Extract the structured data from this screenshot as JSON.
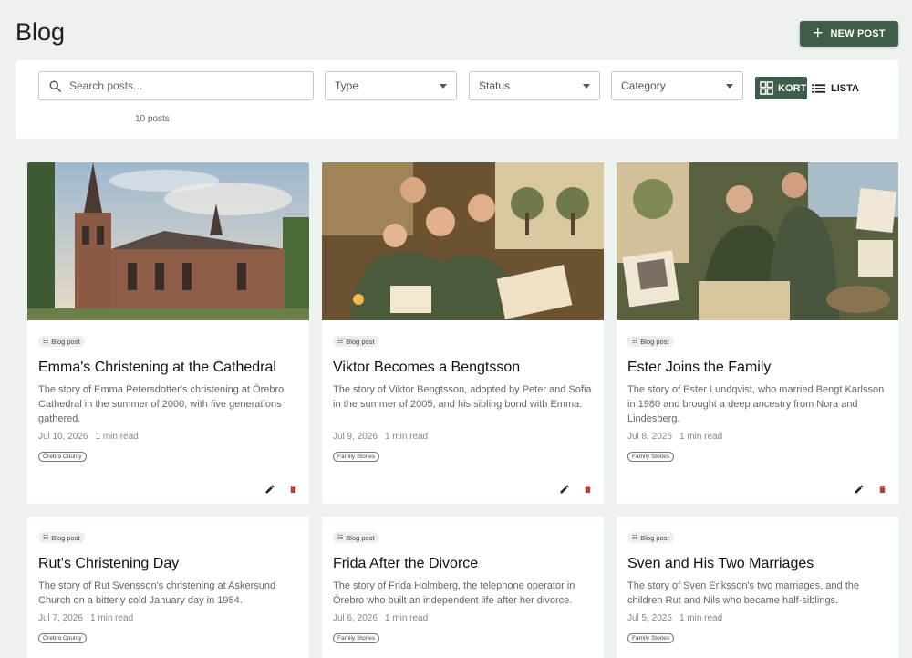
{
  "header": {
    "title": "Blog",
    "new_post_label": "NEW POST"
  },
  "filters": {
    "search_placeholder": "Search posts...",
    "type_label": "Type",
    "status_label": "Status",
    "category_label": "Category",
    "view_card_label": "KORT",
    "view_list_label": "LISTA",
    "post_count": "10 posts"
  },
  "colors": {
    "primary": "#3f5d48",
    "delete": "#b0443a",
    "background": "#eef2ee"
  },
  "posts": [
    {
      "type": "Blog post",
      "title": "Emma's Christening at the Cathedral",
      "description": "The story of Emma Petersdotter's christening at Örebro Cathedral in the summer of 2000, with five generations gathered.",
      "date": "Jul 10, 2026",
      "read_time": "1 min read",
      "category": "Örebro County"
    },
    {
      "type": "Blog post",
      "title": "Viktor Becomes a Bengtsson",
      "description": "The story of Viktor Bengtsson, adopted by Peter and Sofia in the summer of 2005, and his sibling bond with Emma.",
      "date": "Jul 9, 2026",
      "read_time": "1 min read",
      "category": "Family Stories"
    },
    {
      "type": "Blog post",
      "title": "Ester Joins the Family",
      "description": "The story of Ester Lundqvist, who married Bengt Karlsson in 1980 and brought a deep ancestry from Nora and Lindesberg.",
      "date": "Jul 8, 2026",
      "read_time": "1 min read",
      "category": "Family Stories"
    },
    {
      "type": "Blog post",
      "title": "Rut's Christening Day",
      "description": "The story of Rut Svensson's christening at Askersund Church on a bitterly cold January day in 1954.",
      "date": "Jul 7, 2026",
      "read_time": "1 min read",
      "category": "Örebro County"
    },
    {
      "type": "Blog post",
      "title": "Frida After the Divorce",
      "description": "The story of Frida Holmberg, the telephone operator in Örebro who built an independent life after her divorce.",
      "date": "Jul 6, 2026",
      "read_time": "1 min read",
      "category": "Family Stories"
    },
    {
      "type": "Blog post",
      "title": "Sven and His Two Marriages",
      "description": "The story of Sven Eriksson's two marriages, and the children Rut and Nils who became half-siblings.",
      "date": "Jul 5, 2026",
      "read_time": "1 min read",
      "category": "Family Stories"
    }
  ]
}
